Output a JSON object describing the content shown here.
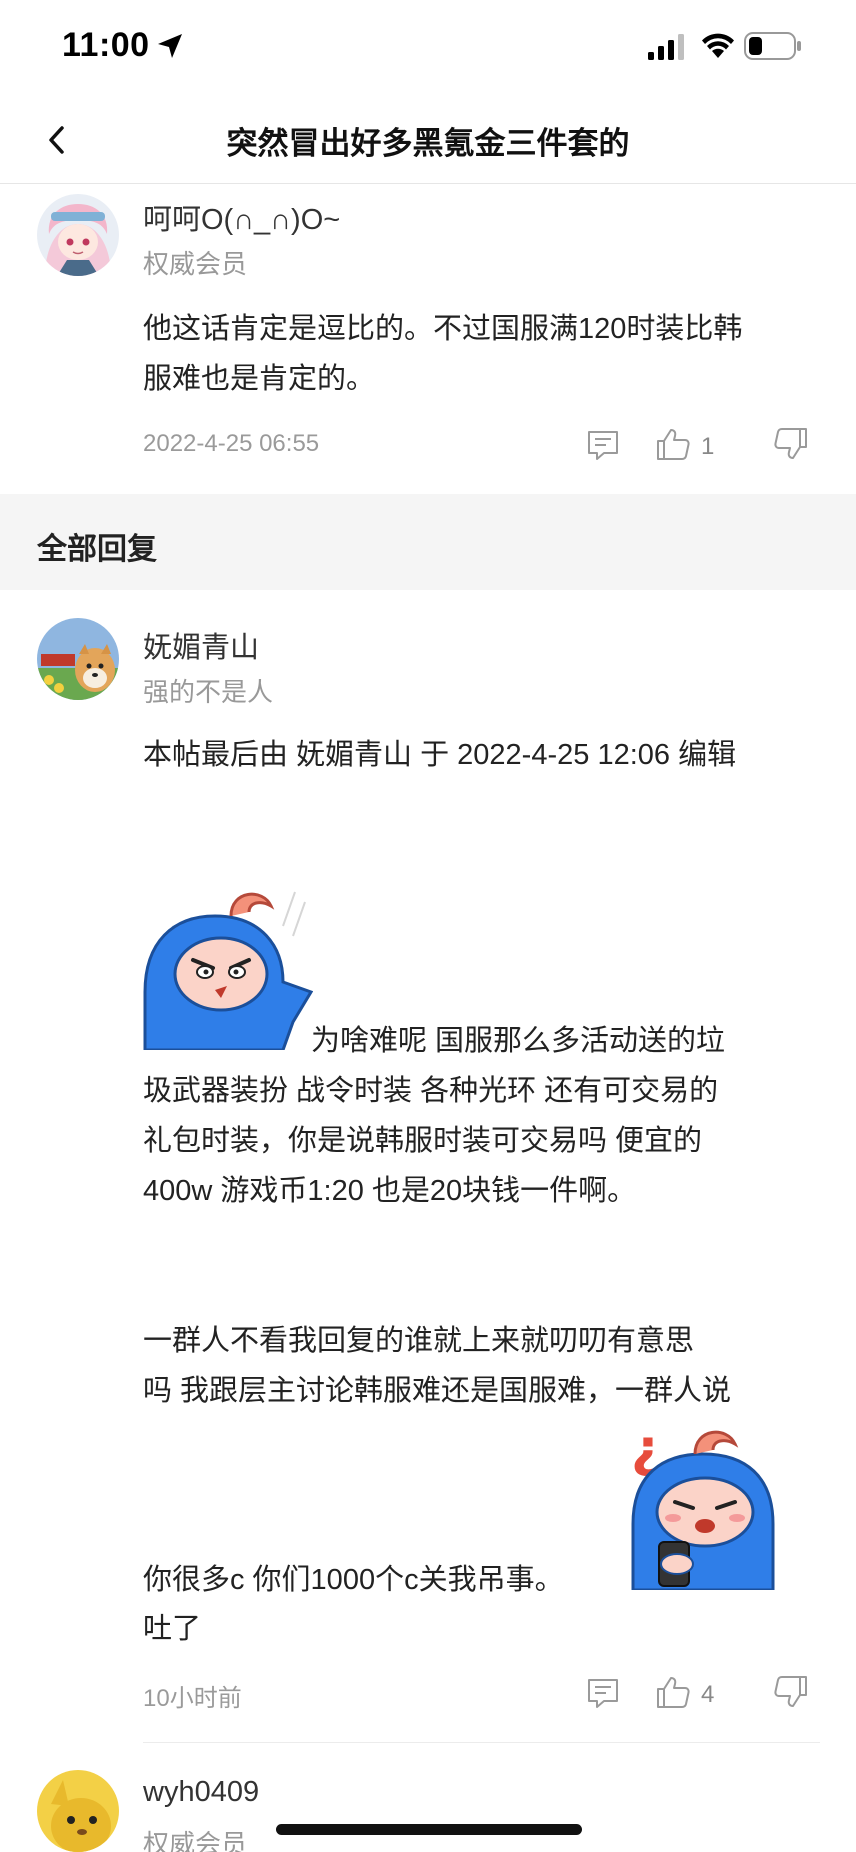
{
  "status_bar": {
    "time": "11:00"
  },
  "nav": {
    "title": "突然冒出好多黑氪金三件套的"
  },
  "quoted_post": {
    "user_name": "呵呵O(∩_∩)O~",
    "user_title": "权威会员",
    "content_lines": [
      "他这话肯定是逗比的。不过国服满120时装比韩",
      "服难也是肯定的。"
    ],
    "date": "2022-4-25 06:55",
    "likes": "1"
  },
  "section": {
    "title": "全部回复"
  },
  "reply": {
    "user_name": "妩媚青山",
    "user_title": "强的不是人",
    "edit_note": "本帖最后由 妩媚青山 于 2022-4-25 12:06 编辑",
    "para1_line1": "为啥难呢   国服那么多活动送的垃",
    "para1_lines": [
      "圾武器装扮   战令时装 各种光环   还有可交易的",
      "礼包时装，你是说韩服时装可交易吗    便宜的",
      "400w  游戏币1:20   也是20块钱一件啊。"
    ],
    "para2_lines": [
      "一群人不看我回复的谁就上来就叨叨有意思",
      "吗  我跟层主讨论韩服难还是国服难，一群人说"
    ],
    "para2_line3": "你很多c   你们1000个c关我吊事。",
    "para2_line4": "吐了",
    "time": "10小时前",
    "likes": "4"
  },
  "next_reply": {
    "user_name": "wyh0409",
    "user_title": "权威会员"
  },
  "colors": {
    "accent_blue": "#2f7ee8",
    "text": "#222222",
    "muted": "#999999",
    "band": "#f5f5f5"
  }
}
